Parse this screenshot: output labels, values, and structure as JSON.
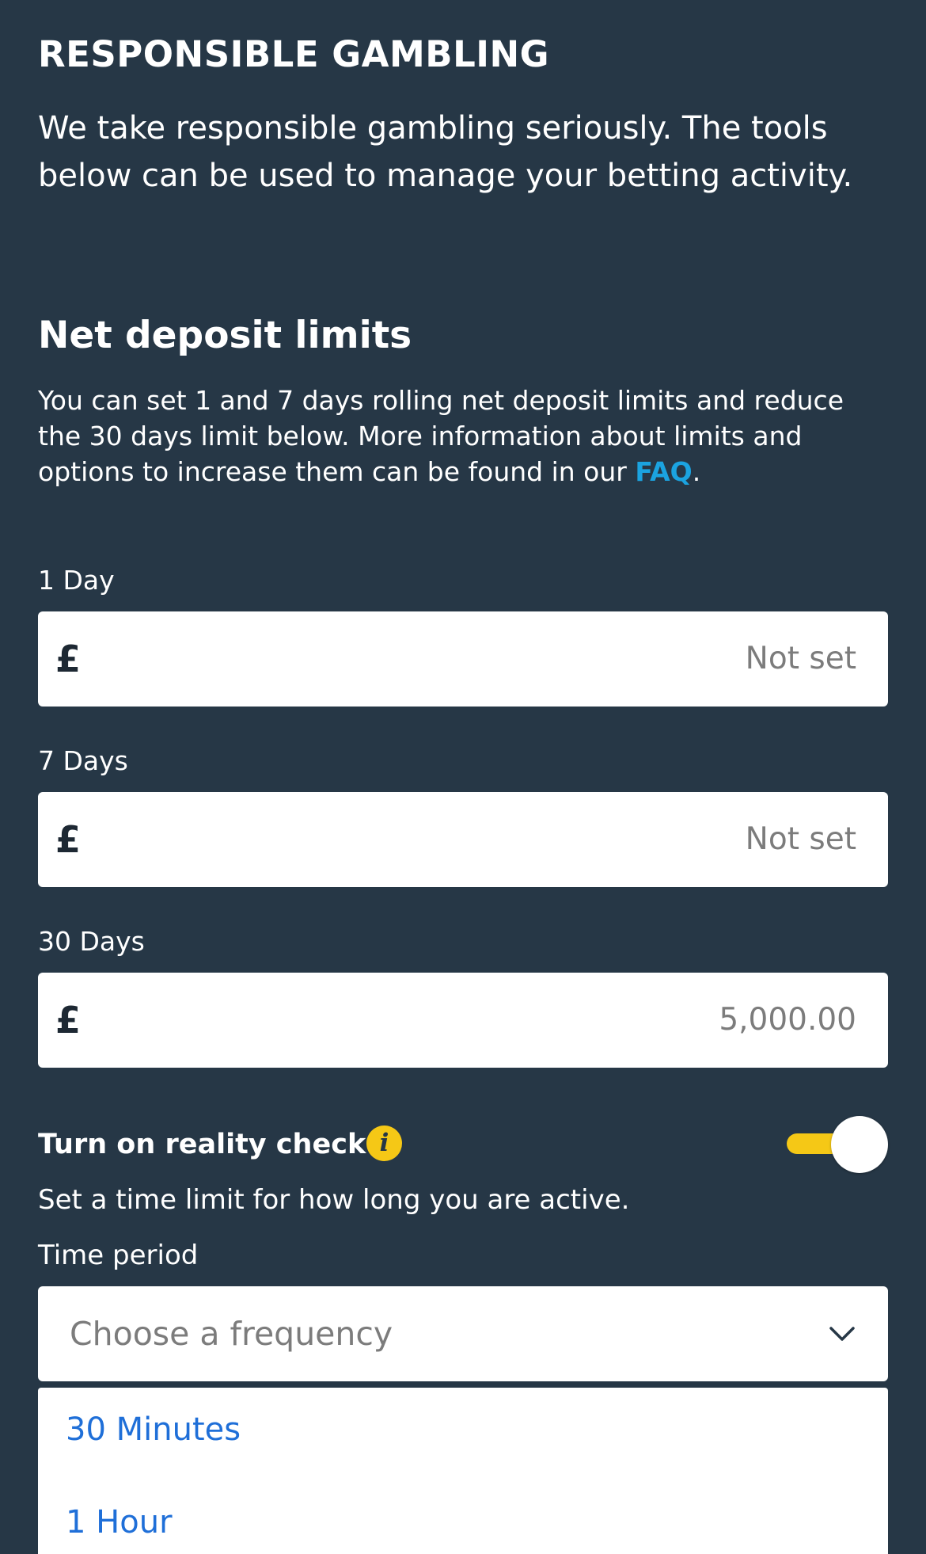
{
  "header": {
    "title": "RESPONSIBLE GAMBLING",
    "intro": "We take responsible gambling seriously. The tools below can be used to manage your betting activity."
  },
  "net_deposit": {
    "title": "Net deposit limits",
    "description": "You can set 1 and 7 days rolling net deposit limits and reduce the 30 days limit below. More information about limits and options to increase them can be found in our ",
    "faq_link": "FAQ",
    "trailing": ".",
    "currency_symbol": "£",
    "limits": [
      {
        "label": "1 Day",
        "value": "Not set"
      },
      {
        "label": "7 Days",
        "value": "Not set"
      },
      {
        "label": "30 Days",
        "value": "5,000.00"
      }
    ]
  },
  "reality_check": {
    "title": "Turn on reality check",
    "info_icon": "info-icon",
    "info_glyph": "i",
    "toggle_on": true,
    "description": "Set a time limit for how long you are active.",
    "time_period_label": "Time period",
    "select_placeholder": "Choose a frequency",
    "options": [
      "30 Minutes",
      "1 Hour"
    ]
  },
  "colors": {
    "background": "#263746",
    "accent_yellow": "#f5c816",
    "link_blue": "#1ba3e0",
    "option_blue": "#1f6fd8"
  }
}
